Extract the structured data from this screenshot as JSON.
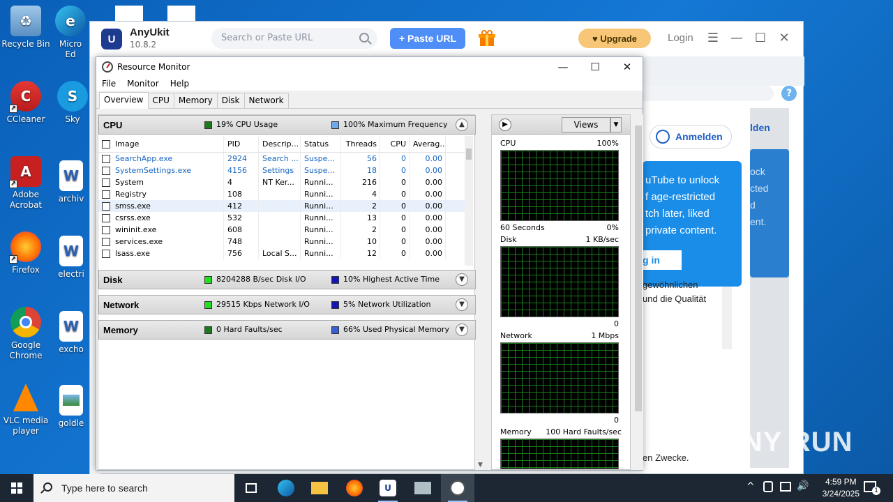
{
  "desktop": {
    "icons": [
      {
        "label": "Recycle Bin"
      },
      {
        "label": "Micro Ed"
      },
      {
        "label": "CCleaner"
      },
      {
        "label": "Sky"
      },
      {
        "label": "Adobe Acrobat"
      },
      {
        "label": "archiv"
      },
      {
        "label": "Firefox"
      },
      {
        "label": "electri"
      },
      {
        "label": "Google Chrome"
      },
      {
        "label": "excho"
      },
      {
        "label": "VLC media player"
      },
      {
        "label": "goldle"
      }
    ]
  },
  "anyukit": {
    "logo": "U",
    "name": "AnyUkit",
    "version": "10.8.2",
    "search_placeholder": "Search or Paste URL",
    "paste_label": "+ Paste URL",
    "upgrade_label": "♥ Upgrade",
    "login_label": "Login",
    "help": "?",
    "anmelden": "Anmelden",
    "len_fragment": "lden",
    "tooltip_lines": [
      "uTube to unlock",
      "f age-restricted",
      "tch later, liked",
      "private content."
    ],
    "tooltip_button": "g in",
    "tooltip2_lines": [
      "ock",
      "cted",
      "d",
      "ent."
    ],
    "text1": "gewöhnlichen",
    "text2": "und die Qualität",
    "text3": "en Zwecke."
  },
  "resmon": {
    "title": "Resource Monitor",
    "menu": [
      "File",
      "Monitor",
      "Help"
    ],
    "tabs": [
      "Overview",
      "CPU",
      "Memory",
      "Disk",
      "Network"
    ],
    "cpu": {
      "name": "CPU",
      "usage_label": "19% CPU Usage",
      "freq_label": "100% Maximum Frequency",
      "usage_color": "#1c7a1c",
      "freq_color": "#6fa8e8"
    },
    "columns": [
      "Image",
      "PID",
      "Descrip...",
      "Status",
      "Threads",
      "CPU",
      "Averag..."
    ],
    "processes": [
      {
        "image": "SearchApp.exe",
        "pid": "2924",
        "desc": "Search ...",
        "status": "Suspe...",
        "threads": "56",
        "cpu": "0",
        "avg": "0.00"
      },
      {
        "image": "SystemSettings.exe",
        "pid": "4156",
        "desc": "Settings",
        "status": "Suspe...",
        "threads": "18",
        "cpu": "0",
        "avg": "0.00"
      },
      {
        "image": "System",
        "pid": "4",
        "desc": "NT Ker...",
        "status": "Runni...",
        "threads": "216",
        "cpu": "0",
        "avg": "0.00"
      },
      {
        "image": "Registry",
        "pid": "108",
        "desc": "",
        "status": "Runni...",
        "threads": "4",
        "cpu": "0",
        "avg": "0.00"
      },
      {
        "image": "smss.exe",
        "pid": "412",
        "desc": "",
        "status": "Runni...",
        "threads": "2",
        "cpu": "0",
        "avg": "0.00"
      },
      {
        "image": "csrss.exe",
        "pid": "532",
        "desc": "",
        "status": "Runni...",
        "threads": "13",
        "cpu": "0",
        "avg": "0.00"
      },
      {
        "image": "wininit.exe",
        "pid": "608",
        "desc": "",
        "status": "Runni...",
        "threads": "2",
        "cpu": "0",
        "avg": "0.00"
      },
      {
        "image": "services.exe",
        "pid": "748",
        "desc": "",
        "status": "Runni...",
        "threads": "10",
        "cpu": "0",
        "avg": "0.00"
      },
      {
        "image": "lsass.exe",
        "pid": "756",
        "desc": "Local S...",
        "status": "Runni...",
        "threads": "12",
        "cpu": "0",
        "avg": "0.00"
      }
    ],
    "disk": {
      "name": "Disk",
      "io_label": "8204288 B/sec Disk I/O",
      "active_label": "10% Highest Active Time",
      "io_color": "#22dd22",
      "active_color": "#1515b0"
    },
    "network": {
      "name": "Network",
      "io_label": "29515 Kbps Network I/O",
      "util_label": "5% Network Utilization",
      "io_color": "#22dd22",
      "util_color": "#1515b0"
    },
    "memory": {
      "name": "Memory",
      "faults_label": "0 Hard Faults/sec",
      "used_label": "66% Used Physical Memory",
      "faults_color": "#1c7a1c",
      "used_color": "#3a5fd0"
    },
    "views_label": "Views",
    "graphs": {
      "cpu": {
        "title": "CPU",
        "max": "100%",
        "xlabel": "60 Seconds",
        "min": "0%"
      },
      "disk": {
        "title": "Disk",
        "max": "1 KB/sec",
        "min": "0"
      },
      "network": {
        "title": "Network",
        "max": "1 Mbps",
        "min": "0"
      },
      "memory": {
        "title": "Memory",
        "max": "100 Hard Faults/sec"
      }
    }
  },
  "taskbar": {
    "search_placeholder": "Type here to search",
    "time": "4:59 PM",
    "date": "3/24/2025",
    "notification_count": "1"
  },
  "watermark": "ANY RUN"
}
